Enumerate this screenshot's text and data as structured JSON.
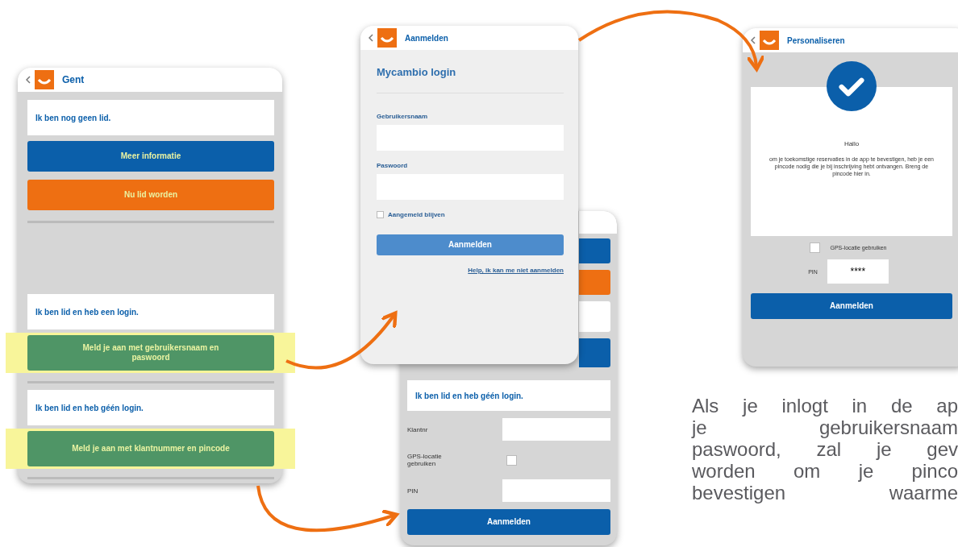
{
  "menu_screen": {
    "title": "Gent",
    "sections": [
      {
        "text": "Ik ben nog geen lid.",
        "buttons": [
          {
            "label": "Meer informatie",
            "color": "#0b5faa",
            "highlighted": false
          },
          {
            "label": "Nu lid worden",
            "color": "#ee6f12",
            "highlighted": false
          }
        ]
      },
      {
        "text": "Ik ben lid en heb een login.",
        "buttons": [
          {
            "label": "Meld je aan met gebruikersnaam en paswoord",
            "color": "#4f9566",
            "highlighted": true
          }
        ]
      },
      {
        "text": "Ik ben lid en heb géén login.",
        "buttons": [
          {
            "label": "Meld je aan met klantnummer en pincode",
            "color": "#4f9566",
            "highlighted": true
          }
        ]
      }
    ]
  },
  "login_screen": {
    "title": "Aanmelden",
    "heading": "Mycambio login",
    "username_label": "Gebruikersnaam",
    "password_label": "Paswoord",
    "remember": {
      "label": "Aangemeld blijven",
      "checked": false
    },
    "button": "Aanmelden",
    "help_link": "Help, ik kan me niet aanmelden"
  },
  "pin_login_screen": {
    "covered_buttons": [
      {
        "color": "#0b5faa"
      },
      {
        "color": "#ee6f12"
      },
      {
        "color": "#ffffff"
      },
      {
        "color": "#0b5faa"
      }
    ],
    "card_text": "Ik ben lid en heb géén login.",
    "customer_label": "Klantnr",
    "gps": {
      "label": "GPS-locatie gebruiken",
      "checked": false
    },
    "pin_label": "PIN",
    "button": "Aanmelden"
  },
  "personalize_screen": {
    "title": "Personaliseren",
    "greeting": "Hallo",
    "message": "om je toekomstige reservaties in de app te bevestigen, heb je een pincode nodig die je bij inschrijving hebt ontvangen. Breng de pincode hier in.",
    "gps": {
      "label": "GPS-locatie gebruiken",
      "checked": false
    },
    "pin_label": "PIN",
    "pin_value": "****",
    "button": "Aanmelden"
  },
  "description": [
    "Als je inlogt in de ap",
    "je gebruikersnaam",
    "paswoord, zal je gev",
    "worden om je pinco",
    "bevestigen waarme"
  ]
}
